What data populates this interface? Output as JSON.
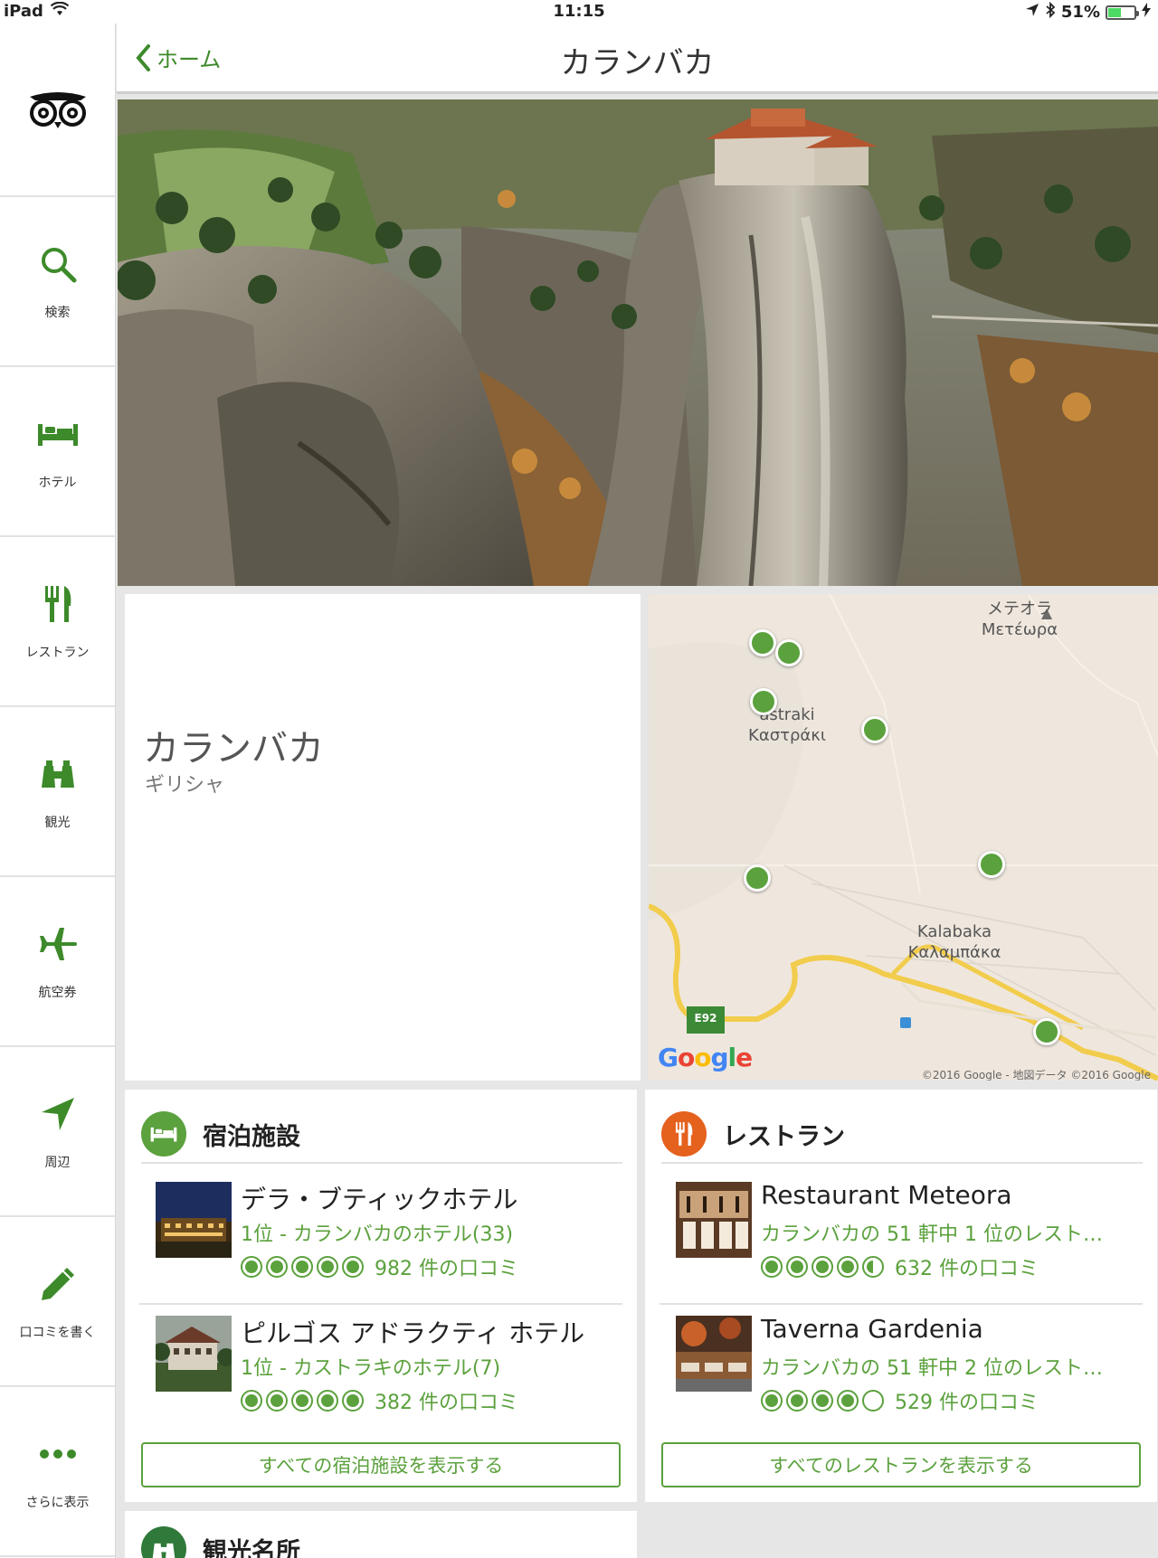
{
  "status_bar": {
    "device": "iPad",
    "time": "11:15",
    "battery": "51%",
    "battery_level": 0.51
  },
  "nav": {
    "back_label": "ホーム",
    "title": "カランバカ"
  },
  "sidebar": {
    "logo_icon": "tripadvisor-owl-icon",
    "items": [
      {
        "label": "検索",
        "icon": "search-icon"
      },
      {
        "label": "ホテル",
        "icon": "bed-icon"
      },
      {
        "label": "レストラン",
        "icon": "fork-knife-icon"
      },
      {
        "label": "観光",
        "icon": "binoculars-icon"
      },
      {
        "label": "航空券",
        "icon": "airplane-icon"
      },
      {
        "label": "周辺",
        "icon": "location-arrow-icon"
      },
      {
        "label": "口コミを書く",
        "icon": "pencil-icon"
      },
      {
        "label": "さらに表示",
        "icon": "more-icon"
      }
    ]
  },
  "place": {
    "name": "カランバカ",
    "country": "ギリシャ"
  },
  "map": {
    "labels": {
      "meteora_ja": "メテオラ",
      "meteora_gr": "Μετέωρα",
      "kastraki_en": "astraki",
      "kastraki_gr": "Καστράκι",
      "kalabaka_en": "Kalabaka",
      "kalabaka_gr": "Καλαμπάκα",
      "road": "E92"
    },
    "google": "Google",
    "copyright": "©2016 Google - 地図データ ©2016 Google"
  },
  "lodging": {
    "title": "宿泊施設",
    "items": [
      {
        "name": "デラ・ブティックホテル",
        "rank": "1位 - カランバカのホテル(33)",
        "rating": 5,
        "reviews": "982 件の口コミ"
      },
      {
        "name": "ピルゴス アドラクティ ホテル",
        "rank": "1位 - カストラキのホテル(7)",
        "rating": 5,
        "reviews": "382 件の口コミ"
      }
    ],
    "show_all": "すべての宿泊施設を表示する"
  },
  "restaurants": {
    "title": "レストラン",
    "items": [
      {
        "name": "Restaurant Meteora",
        "rank": "カランバカの 51 軒中 1 位のレスト…",
        "rating": 4.5,
        "reviews": "632 件の口コミ"
      },
      {
        "name": "Taverna Gardenia",
        "rank": "カランバカの 51 軒中 2 位のレスト…",
        "rating": 4,
        "reviews": "529 件の口コミ"
      }
    ],
    "show_all": "すべてのレストランを表示する"
  },
  "attractions": {
    "title": "観光名所"
  },
  "colors": {
    "green": "#5ba13d",
    "orange": "#e5611e",
    "dark_green": "#2f7a3a"
  }
}
